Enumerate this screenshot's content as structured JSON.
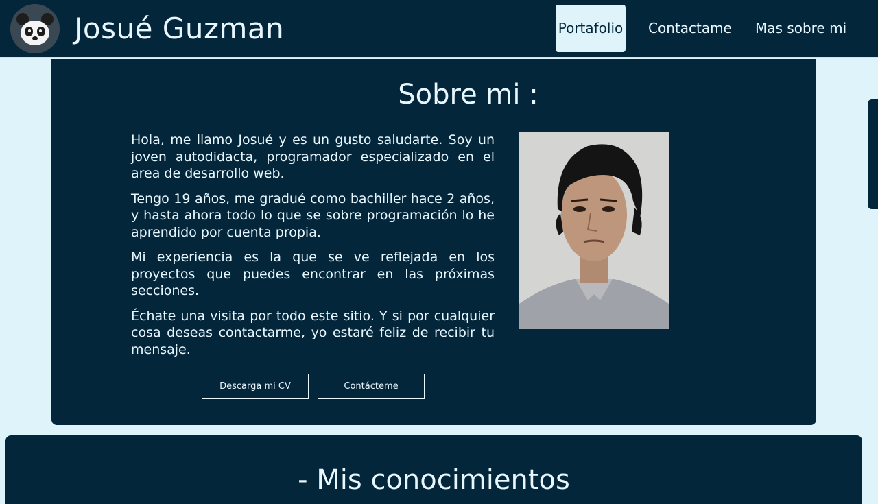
{
  "header": {
    "logo_icon": "panda-icon",
    "title": "Josué Guzman",
    "nav": [
      {
        "label": "Portafolio",
        "active": true
      },
      {
        "label": "Contactame",
        "active": false
      },
      {
        "label": "Mas sobre mi",
        "active": false
      }
    ]
  },
  "about": {
    "title": "Sobre mi :",
    "paragraphs": [
      "Hola, me llamo Josué y es un gusto saludarte. Soy un joven autodidacta, programador especializado en el area de desarrollo web.",
      "Tengo 19 años, me gradué como bachiller hace 2 años, y hasta ahora todo lo que se sobre programación lo he aprendido por cuenta propia.",
      "Mi experiencia es la que se ve reflejada en los proyectos que puedes encontrar en las próximas secciones.",
      "Échate una visita por todo este sitio. Y si por cualquier cosa deseas contactarme, yo estaré feliz de recibir tu mensaje."
    ],
    "photo_icon": "profile-photo",
    "buttons": {
      "cv": "Descarga mi CV",
      "contact": "Contácteme"
    }
  },
  "skills": {
    "title": "- Mis conocimientos"
  },
  "colors": {
    "navy": "#04263b",
    "background": "#dff3fb",
    "text": "#e8f6fd"
  }
}
